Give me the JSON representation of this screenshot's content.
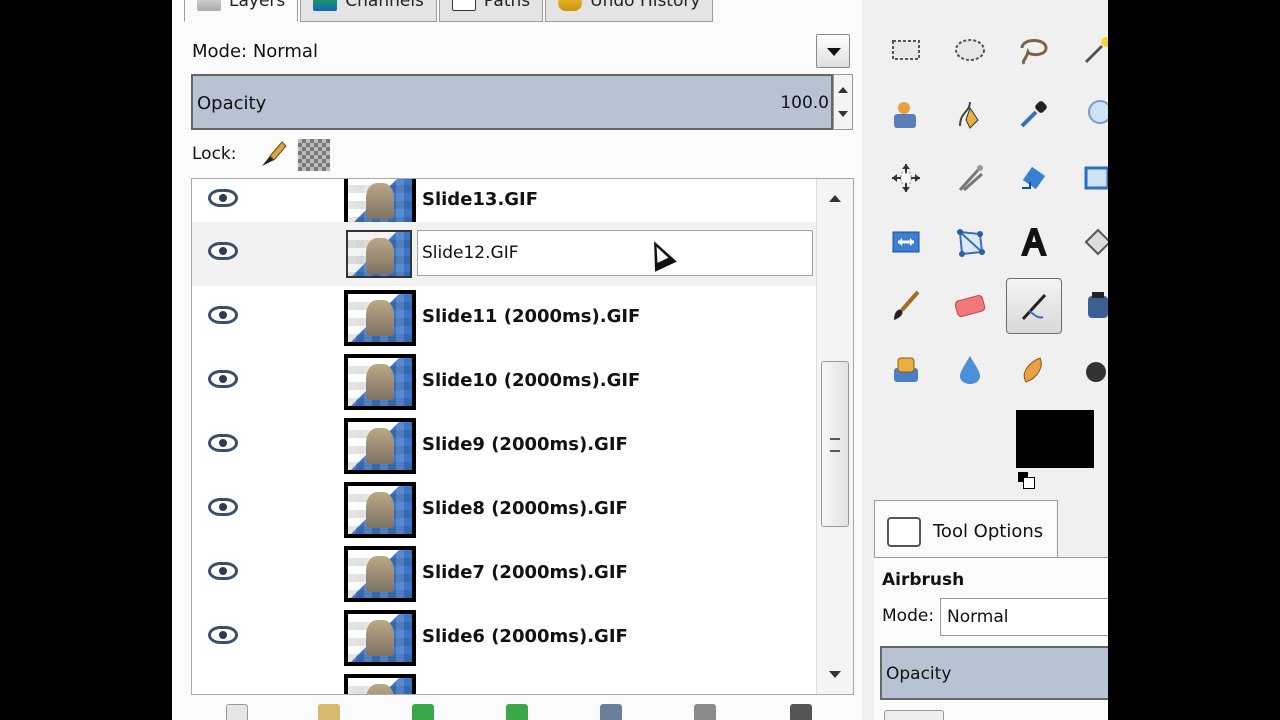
{
  "layers_dock": {
    "tabs": [
      {
        "label": "Layers",
        "icon": "layers-icon"
      },
      {
        "label": "Channels",
        "icon": "channels-icon"
      },
      {
        "label": "Paths",
        "icon": "paths-icon"
      },
      {
        "label": "Undo History",
        "icon": "undo-history-icon"
      }
    ],
    "mode_label": "Mode: Normal",
    "opacity_label": "Opacity",
    "opacity_value": "100.0",
    "lock_label": "Lock:",
    "rename_value": "Slide12.GIF",
    "layers": [
      {
        "name": "Slide13.GIF"
      },
      {
        "name": "Slide12.GIF",
        "editing": true
      },
      {
        "name": "Slide11 (2000ms).GIF"
      },
      {
        "name": "Slide10 (2000ms).GIF"
      },
      {
        "name": "Slide9 (2000ms).GIF"
      },
      {
        "name": "Slide8 (2000ms).GIF"
      },
      {
        "name": "Slide7 (2000ms).GIF"
      },
      {
        "name": "Slide6 (2000ms).GIF"
      }
    ]
  },
  "toolbox": {
    "tools": [
      "rect-select-icon",
      "ellipse-select-icon",
      "lasso-icon",
      "fuzzy-select-icon",
      "foreground-select-icon",
      "paths-tool-icon",
      "color-picker-icon",
      "zoom-icon",
      "move-icon",
      "crop-icon",
      "rotate-icon",
      "scale-icon",
      "flip-icon",
      "cage-transform-icon",
      "text-icon",
      "bucket-fill-icon",
      "paintbrush-icon",
      "eraser-icon",
      "airbrush-icon",
      "ink-icon",
      "clone-icon",
      "blur-icon",
      "smudge-icon",
      "dodge-burn-icon"
    ],
    "active_tool": "airbrush-icon",
    "fg_color": "#000000"
  },
  "tool_options": {
    "tab_label": "Tool Options",
    "tool_name": "Airbrush",
    "mode_label": "Mode:",
    "mode_value": "Normal",
    "opacity_label": "Opacity"
  },
  "colors": {
    "accent": "#b7c3d2",
    "panel": "#fbfbfb"
  }
}
